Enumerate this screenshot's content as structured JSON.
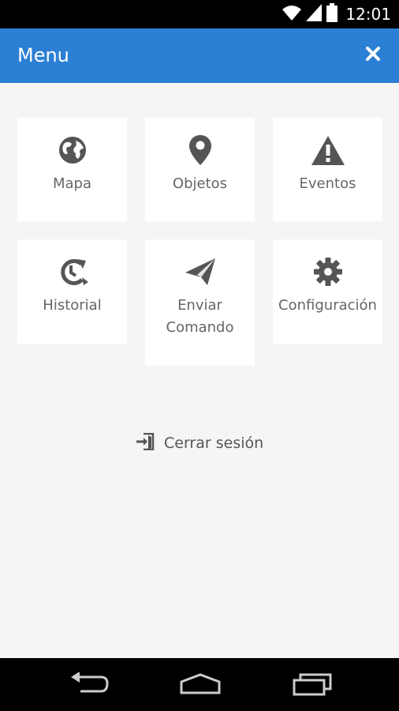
{
  "status": {
    "time": "12:01"
  },
  "header": {
    "title": "Menu",
    "close_icon": "close-icon"
  },
  "menu": {
    "items": [
      {
        "label": "Mapa",
        "icon": "globe-icon"
      },
      {
        "label": "Objetos",
        "icon": "map-pin-icon"
      },
      {
        "label": "Eventos",
        "icon": "warning-icon"
      },
      {
        "label": "Historial",
        "icon": "history-icon"
      },
      {
        "label": "Enviar\nComando",
        "icon": "send-icon"
      },
      {
        "label": "Configuración",
        "icon": "gear-icon"
      }
    ]
  },
  "logout": {
    "label": "Cerrar sesión",
    "icon": "sign-out-icon"
  },
  "colors": {
    "accent": "#2b7fd4",
    "icon": "#555555",
    "label": "#666666",
    "background": "#f5f5f5",
    "tile": "#ffffff"
  },
  "navigation": {
    "buttons": [
      "back-icon",
      "home-icon",
      "recent-apps-icon"
    ]
  }
}
